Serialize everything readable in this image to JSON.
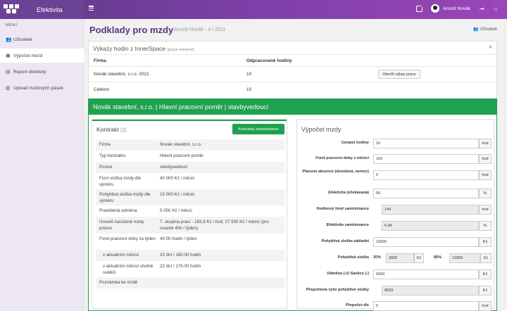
{
  "app": {
    "name": "Efektivita"
  },
  "topbar": {
    "user_name": "Arnošt Novák",
    "notification_count": ""
  },
  "sidebar": {
    "menu_title": "MENU",
    "items": [
      {
        "label": "Uživatelé",
        "icon": "users-icon"
      },
      {
        "label": "Výpočet mezd",
        "icon": "calculator-icon"
      },
      {
        "label": "Report efektivity",
        "icon": "report-icon"
      },
      {
        "label": "Upload mzdových pásek",
        "icon": "upload-icon"
      }
    ]
  },
  "page": {
    "title": "Podklady pro mzdy",
    "subtitle": "Arnošt Novák - 4 / 2021",
    "users_link": "Uživatelé"
  },
  "hours_card": {
    "title": "Výkazy hodin z InnerSpace",
    "title_note": "(pouze nenulové)",
    "headers": [
      "Firma",
      "Odpracované hodiny"
    ],
    "rows": [
      {
        "firm": "Novák stavební, s.r.o. 2021",
        "hours": "10",
        "button": "Otevřít výkaz práce"
      }
    ],
    "total_label": "Celkem",
    "total_value": "10"
  },
  "contract_section": {
    "header": "Novák stavební, s.r.o. | Hlavní pracovní poměr | stavbyvedoucí",
    "contract": {
      "title": "Kontrakt",
      "count": "(2)",
      "button": "Kontrakty zaměstnance",
      "rows": [
        {
          "k": "Firma",
          "v": "Novák stavební, s.r.o."
        },
        {
          "k": "Typ kontraktu",
          "v": "Hlavní pracovní poměr"
        },
        {
          "k": "Pozice",
          "v": "stavbyvedoucí"
        },
        {
          "k": "Fixní složka mzdy dle výměru",
          "v": "40 000 Kč / měsíc"
        },
        {
          "k": "Pohyblivá složka mzdy dle výměru",
          "v": "15 000 Kč / měsíc"
        },
        {
          "k": "Pravidelná odměna",
          "v": "5 000 Kč / měsíc"
        },
        {
          "k": "Úroveň zaručené mzdy pozice",
          "v": "7. skupina prací - 163,9 Kč / hod, 27 500 Kč / měsíc (pro úvazek 40h / týden)"
        },
        {
          "k": "Fond pracovní doby za týden",
          "v": "40.00 hodin / týden"
        },
        {
          "k": "v aktuálním měsíci",
          "v": "20 dní / 160.00 hodin"
        },
        {
          "k": "v aktuálním měsíci včetně svátků",
          "v": "22 dní / 176.00 hodin"
        },
        {
          "k": "Poznámka ke mzdě",
          "v": ""
        }
      ]
    },
    "calc": {
      "title": "Výpočet mzdy",
      "fields": [
        {
          "label": "Uznané hodiny",
          "value": "10",
          "unit": "hod",
          "readonly": false
        },
        {
          "label": "Fond pracovní doby v měsíci",
          "value": "160",
          "unit": "hod",
          "readonly": false
        },
        {
          "label": "Placené absence (dovolená, nemoc)",
          "value": "0",
          "unit": "hod",
          "readonly": false
        },
        {
          "label": "Efektivita (očekávaná)",
          "value": "90",
          "unit": "%",
          "readonly": false
        },
        {
          "label": "Hodinový fond zaměstnance",
          "value": "144",
          "unit": "hod",
          "readonly": true
        },
        {
          "label": "Efektivita zaměstnance",
          "value": "6,94",
          "unit": "%",
          "readonly": true
        },
        {
          "label": "Pohyblivá složka základní",
          "value": "15000",
          "unit": "Kč",
          "readonly": false
        }
      ],
      "split": {
        "label": "Pohyblivá složka",
        "pct1": "20%",
        "val1": "3000",
        "unit1": "Kč",
        "pct2": "80%",
        "val2": "12000",
        "unit2": "Kč"
      },
      "fields2": [
        {
          "label": "Odměna (+)/ Sankce (-)",
          "value": "5000",
          "unit": "Kč",
          "readonly": false
        },
        {
          "label": "Přepočtená výše pohyblivé složky",
          "value": "8833",
          "unit": "Kč",
          "readonly": true
        },
        {
          "label": "Přepočet dle",
          "value": "0",
          "unit": "hod",
          "readonly": false
        }
      ]
    }
  }
}
